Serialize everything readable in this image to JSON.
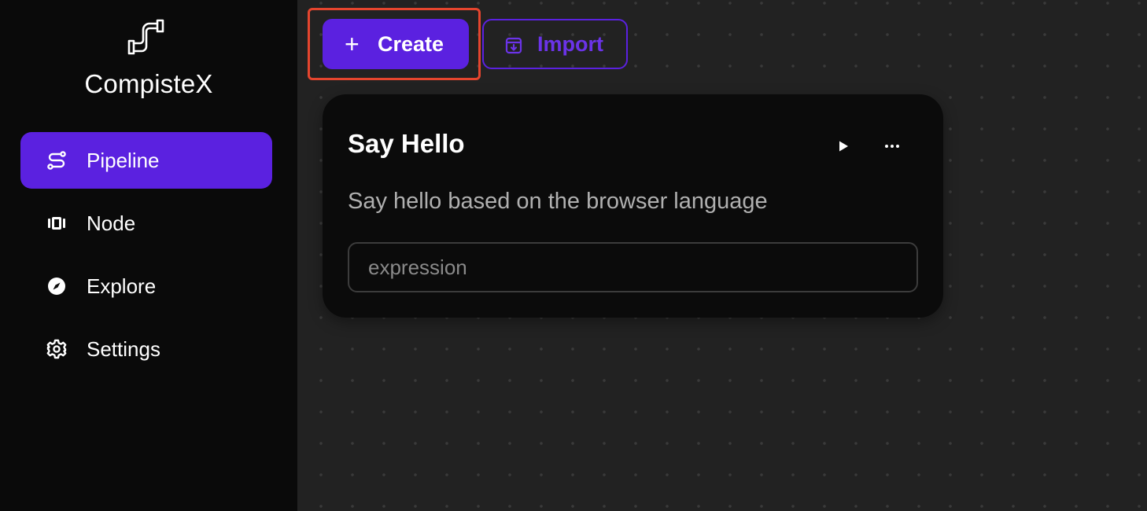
{
  "app": {
    "name": "CompisteX"
  },
  "sidebar": {
    "items": [
      {
        "label": "Pipeline",
        "icon": "route-icon",
        "active": true
      },
      {
        "label": "Node",
        "icon": "columns-icon",
        "active": false
      },
      {
        "label": "Explore",
        "icon": "compass-icon",
        "active": false
      },
      {
        "label": "Settings",
        "icon": "gear-icon",
        "active": false
      }
    ]
  },
  "toolbar": {
    "create_label": "Create",
    "create_icon": "plus-icon",
    "import_label": "Import",
    "import_icon": "import-box-icon"
  },
  "pipelines": [
    {
      "title": "Say Hello",
      "description": "Say hello based on the browser language",
      "input_placeholder": "expression",
      "input_value": ""
    }
  ],
  "colors": {
    "accent": "#5b21e0",
    "highlight": "#e5452e",
    "sidebar_bg": "#0a0a0a",
    "main_bg": "#222222",
    "card_bg": "#0b0b0b"
  }
}
